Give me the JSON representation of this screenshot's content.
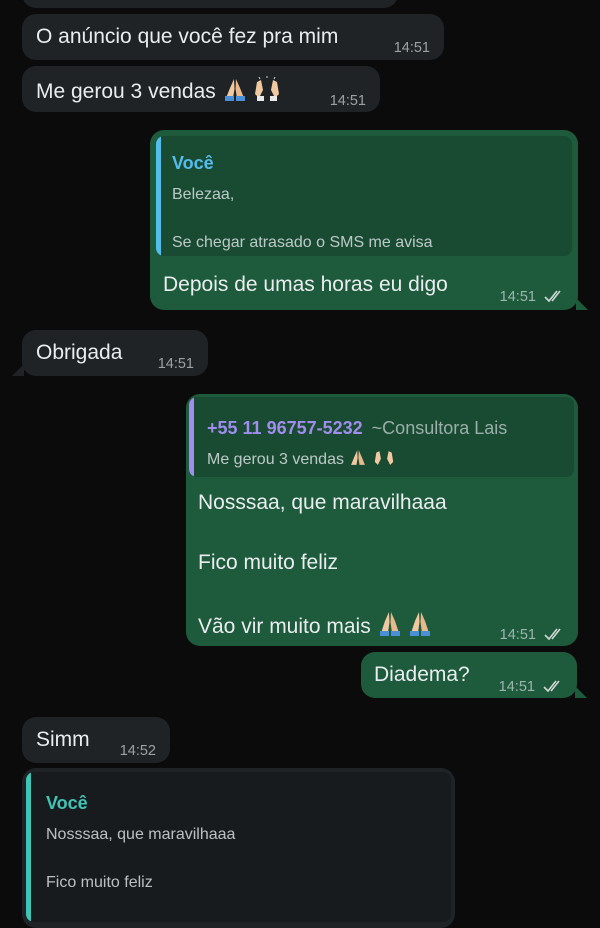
{
  "messages": {
    "m0": {
      "text": ""
    },
    "m1": {
      "text": "O anúncio que você fez pra mim",
      "time": "14:51"
    },
    "m2": {
      "text": "Me gerou 3 vendas",
      "time": "14:51"
    },
    "m3": {
      "quote_author": "Você",
      "quote_line1": "Belezaa,",
      "quote_line2": "Se chegar atrasado o SMS me avisa",
      "text": "Depois de umas horas eu digo",
      "time": "14:51"
    },
    "m4": {
      "text": "Obrigada",
      "time": "14:51"
    },
    "m5": {
      "quote_author": "+55 11 96757-5232",
      "quote_author_alias": "~Consultora Lais",
      "quote_text": "Me gerou 3 vendas",
      "line1": "Nosssaa, que maravilhaaa",
      "line2": "Fico muito feliz",
      "line3": "Vão vir muito mais",
      "time": "14:51"
    },
    "m6": {
      "text": "Diadema?",
      "time": "14:51"
    },
    "m7": {
      "text": "Simm",
      "time": "14:52"
    },
    "m8": {
      "quote_author": "Você",
      "quote_line1": "Nosssaa, que maravilhaaa",
      "quote_line2": "Fico muito feliz"
    }
  },
  "icons": {
    "read_receipt": "double-check-icon",
    "emoji_pray": "folded-hands-emoji",
    "emoji_raise": "raising-hands-emoji"
  },
  "colors": {
    "background": "#0b0b0c",
    "incoming_bubble": "#1f2326",
    "outgoing_bubble": "#1e5a3c",
    "you_author": "#53bdeb",
    "contact_author": "#a18cf0"
  }
}
